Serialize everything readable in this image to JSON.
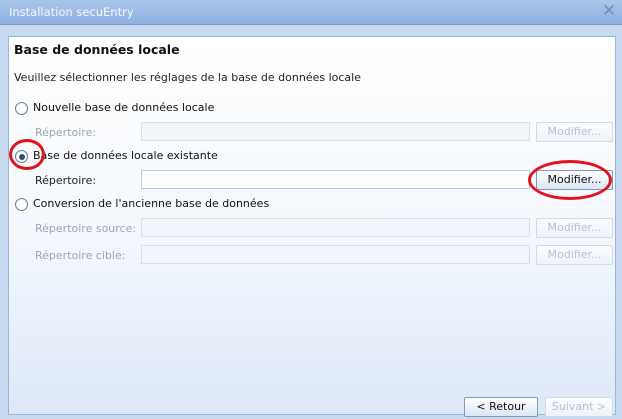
{
  "window": {
    "title": "Installation secuEntry"
  },
  "page": {
    "heading": "Base de données locale",
    "subtitle": "Veuillez sélectionner les réglages de la base de données locale"
  },
  "options": [
    {
      "label": "Nouvelle base de données locale",
      "selected": false,
      "fields": [
        {
          "label": "Répertoire:",
          "value": "",
          "button": "Modifier...",
          "enabled": false
        }
      ]
    },
    {
      "label": "Base de données locale existante",
      "selected": true,
      "fields": [
        {
          "label": "Répertoire:",
          "value": "",
          "button": "Modifier...",
          "enabled": true
        }
      ]
    },
    {
      "label": "Conversion de l'ancienne base de données",
      "selected": false,
      "fields": [
        {
          "label": "Répertoire source:",
          "value": "",
          "button": "Modifier...",
          "enabled": false
        },
        {
          "label": "Répertoire cible:",
          "value": "",
          "button": "Modifier...",
          "enabled": false
        }
      ]
    }
  ],
  "footer": {
    "back_label": "< Retour",
    "next_label": "Suivant >"
  },
  "colors": {
    "highlight": "#e0141c",
    "title_bar": "#9bb9e4"
  }
}
